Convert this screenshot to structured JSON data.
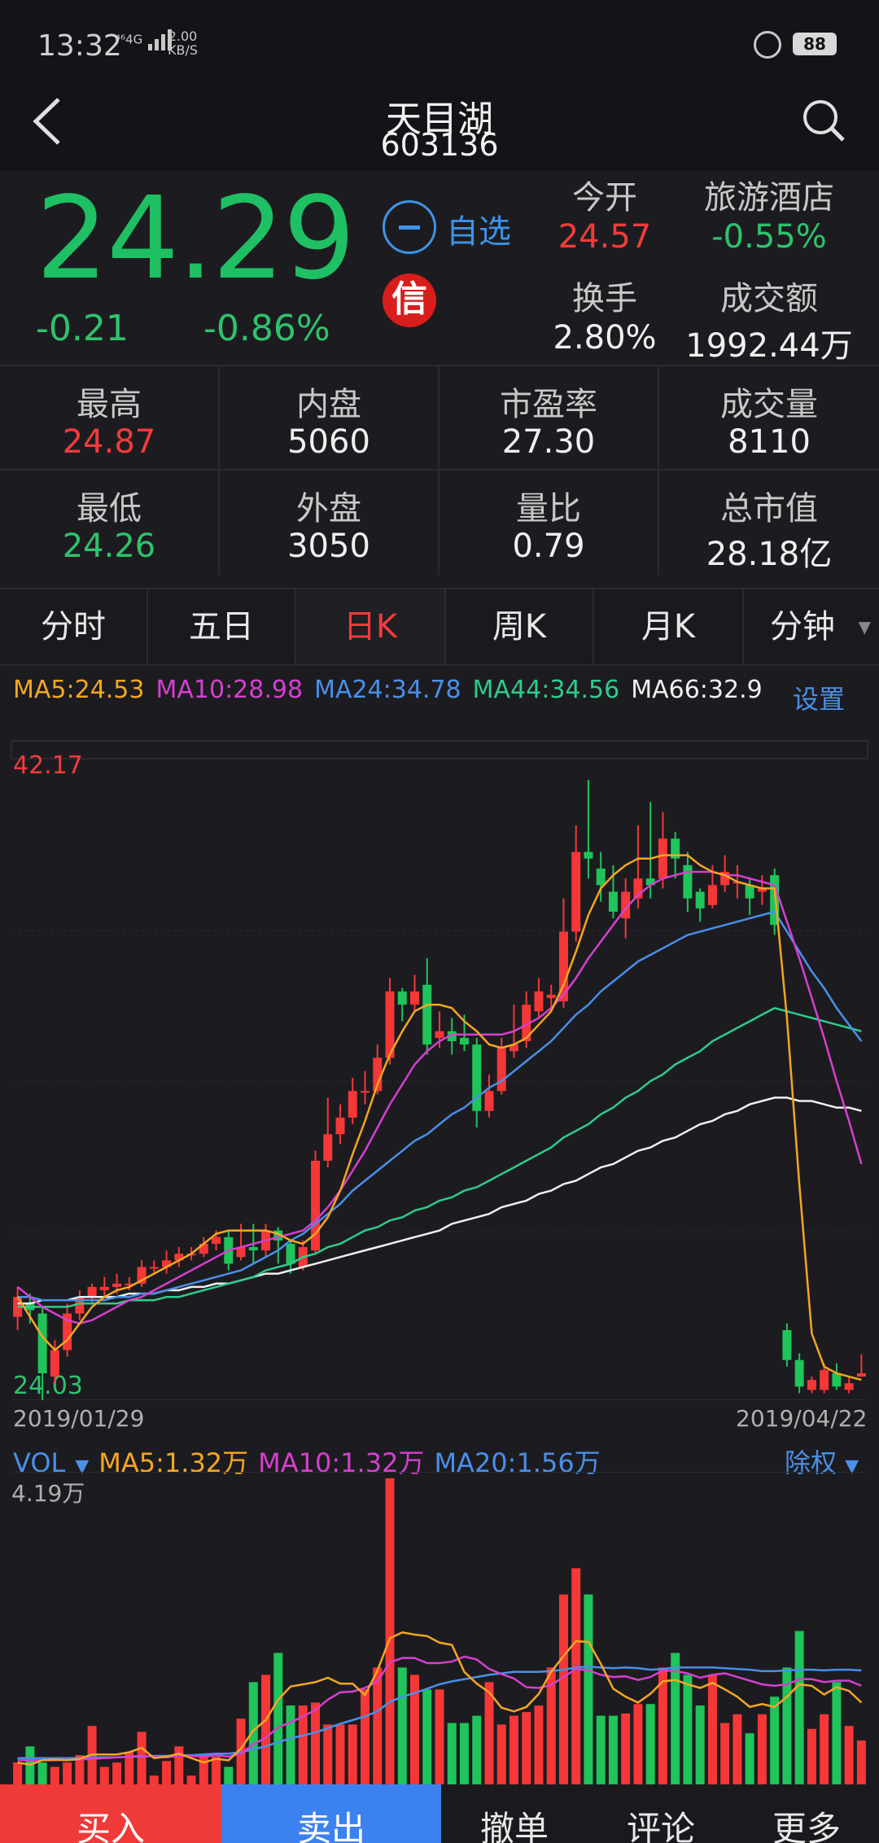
{
  "status": {
    "time": "13:32",
    "net": "⁴⁶4G",
    "speed_top": "2.00",
    "speed_bottom": "KB/S",
    "battery": "88"
  },
  "header": {
    "title": "天目湖",
    "code": "603136"
  },
  "quote": {
    "price": "24.29",
    "change": "-0.21",
    "change_pct": "-0.86%",
    "watch_label": "自选",
    "xin": "信",
    "open_label": "今开",
    "open_value": "24.57",
    "sector_label": "旅游酒店",
    "sector_value": "-0.55%",
    "turnover_label": "换手",
    "turnover_value": "2.80%",
    "amount_label": "成交额",
    "amount_value": "1992.44万"
  },
  "stats": [
    [
      {
        "label": "最高",
        "value": "24.87",
        "color": "#f23b3b"
      },
      {
        "label": "内盘",
        "value": "5060",
        "color": "#f0f0f0"
      },
      {
        "label": "市盈率",
        "value": "27.30",
        "color": "#f0f0f0"
      },
      {
        "label": "成交量",
        "value": "8110",
        "color": "#f0f0f0"
      }
    ],
    [
      {
        "label": "最低",
        "value": "24.26",
        "color": "#2ec36c"
      },
      {
        "label": "外盘",
        "value": "3050",
        "color": "#f0f0f0"
      },
      {
        "label": "量比",
        "value": "0.79",
        "color": "#f0f0f0"
      },
      {
        "label": "总市值",
        "value": "28.18亿",
        "color": "#f0f0f0"
      }
    ]
  ],
  "tabs": [
    "分时",
    "五日",
    "日K",
    "周K",
    "月K",
    "分钟"
  ],
  "tab_active": 2,
  "ma": [
    {
      "text": "MA5:24.53",
      "color": "#f5a623"
    },
    {
      "text": "MA10:28.98",
      "color": "#d63fd0"
    },
    {
      "text": "MA24:34.78",
      "color": "#4a8fe8"
    },
    {
      "text": "MA44:34.56",
      "color": "#2ecc8a"
    },
    {
      "text": "MA66:32.9",
      "color": "#f0f0f0"
    }
  ],
  "settings_label": "设置",
  "colors": {
    "up": "#f53737",
    "down": "#1fc45a"
  },
  "chart_data": {
    "type": "candlestick",
    "price_max_label": "42.17",
    "price_min_label": "24.03",
    "ylim": [
      24.03,
      42.17
    ],
    "date_start": "2019/01/29",
    "date_end": "2019/04/22",
    "candles": [
      [
        26.0,
        26.6,
        26.9,
        25.6
      ],
      [
        26.4,
        26.2,
        26.7,
        25.8
      ],
      [
        26.1,
        24.3,
        26.3,
        23.2
      ],
      [
        24.2,
        25.0,
        25.3,
        24.0
      ],
      [
        25.0,
        26.1,
        26.4,
        24.8
      ],
      [
        26.1,
        26.6,
        26.8,
        25.9
      ],
      [
        26.6,
        26.9,
        27.0,
        26.4
      ],
      [
        26.8,
        26.9,
        27.2,
        26.6
      ],
      [
        26.9,
        27.0,
        27.3,
        26.7
      ],
      [
        27.0,
        27.0,
        27.2,
        26.8
      ],
      [
        27.0,
        27.5,
        27.7,
        26.9
      ],
      [
        27.5,
        27.5,
        27.7,
        27.3
      ],
      [
        27.5,
        27.7,
        28.0,
        27.3
      ],
      [
        27.7,
        27.9,
        28.1,
        27.5
      ],
      [
        27.9,
        27.9,
        28.1,
        27.7
      ],
      [
        27.9,
        28.2,
        28.4,
        27.8
      ],
      [
        28.2,
        28.4,
        28.6,
        28.0
      ],
      [
        28.4,
        27.6,
        28.6,
        27.4
      ],
      [
        27.8,
        28.1,
        28.8,
        27.7
      ],
      [
        28.1,
        28.0,
        28.8,
        27.6
      ],
      [
        28.0,
        28.6,
        28.8,
        27.8
      ],
      [
        28.6,
        28.3,
        28.7,
        27.6
      ],
      [
        28.2,
        27.6,
        28.3,
        27.3
      ],
      [
        27.5,
        28.1,
        28.3,
        27.4
      ],
      [
        28.0,
        30.7,
        31.0,
        27.9
      ],
      [
        30.7,
        31.5,
        32.6,
        30.5
      ],
      [
        31.5,
        32.0,
        32.4,
        31.2
      ],
      [
        32.0,
        32.8,
        33.2,
        31.8
      ],
      [
        32.8,
        32.8,
        33.4,
        32.4
      ],
      [
        32.8,
        33.8,
        34.2,
        32.7
      ],
      [
        33.8,
        35.8,
        36.2,
        33.6
      ],
      [
        35.8,
        35.4,
        35.9,
        34.9
      ],
      [
        35.4,
        35.8,
        36.3,
        35.2
      ],
      [
        36.0,
        34.2,
        36.8,
        33.9
      ],
      [
        34.4,
        34.6,
        35.2,
        34.1
      ],
      [
        34.6,
        34.3,
        35.0,
        33.9
      ],
      [
        34.4,
        34.2,
        35.1,
        34.0
      ],
      [
        34.2,
        32.2,
        34.4,
        31.7
      ],
      [
        32.2,
        32.8,
        33.3,
        32.0
      ],
      [
        32.8,
        34.1,
        34.4,
        32.7
      ],
      [
        34.0,
        34.2,
        35.4,
        33.8
      ],
      [
        34.3,
        35.4,
        35.8,
        34.1
      ],
      [
        35.2,
        35.8,
        36.2,
        35.0
      ],
      [
        35.6,
        35.7,
        36.0,
        35.3
      ],
      [
        35.5,
        37.6,
        38.6,
        35.3
      ],
      [
        37.6,
        40.0,
        40.8,
        37.3
      ],
      [
        40.0,
        39.8,
        42.17,
        39.2
      ],
      [
        39.5,
        39.0,
        40.0,
        38.5
      ],
      [
        38.8,
        38.2,
        39.6,
        38.0
      ],
      [
        38.0,
        38.8,
        39.2,
        37.4
      ],
      [
        38.6,
        39.2,
        40.8,
        38.3
      ],
      [
        39.2,
        39.0,
        41.5,
        38.6
      ],
      [
        39.2,
        40.4,
        41.2,
        38.9
      ],
      [
        40.4,
        39.8,
        40.6,
        39.2
      ],
      [
        39.6,
        38.6,
        40.0,
        38.2
      ],
      [
        38.8,
        38.3,
        38.9,
        37.9
      ],
      [
        38.4,
        39.0,
        39.6,
        38.3
      ],
      [
        39.0,
        39.4,
        39.9,
        38.8
      ],
      [
        39.1,
        39.1,
        39.6,
        38.6
      ],
      [
        39.0,
        38.6,
        39.2,
        38.1
      ],
      [
        38.8,
        38.9,
        39.3,
        38.4
      ],
      [
        39.3,
        37.8,
        39.5,
        37.5
      ],
      [
        25.6,
        24.7,
        25.8,
        24.5
      ],
      [
        24.7,
        23.9,
        24.9,
        23.7
      ],
      [
        23.8,
        24.1,
        24.2,
        23.7
      ],
      [
        23.8,
        24.4,
        24.6,
        23.7
      ],
      [
        24.3,
        23.9,
        24.6,
        23.8
      ],
      [
        23.8,
        24.0,
        24.2,
        23.7
      ],
      [
        24.2,
        24.3,
        24.87,
        24.26
      ]
    ],
    "ma5": [
      26.6,
      26.0,
      25.4,
      25.0,
      25.3,
      25.8,
      26.3,
      26.6,
      26.8,
      26.9,
      27.1,
      27.3,
      27.5,
      27.7,
      27.9,
      28.2,
      28.5,
      28.6,
      28.6,
      28.6,
      28.6,
      28.5,
      28.3,
      28.2,
      28.5,
      29.0,
      29.8,
      30.9,
      31.9,
      33.0,
      33.9,
      34.6,
      35.2,
      35.4,
      35.4,
      35.3,
      34.9,
      34.6,
      34.2,
      34.1,
      34.2,
      34.4,
      34.8,
      35.2,
      36.0,
      37.0,
      38.1,
      38.9,
      39.3,
      39.6,
      39.8,
      39.8,
      39.9,
      39.9,
      39.9,
      39.6,
      39.4,
      39.3,
      39.1,
      39.0,
      38.9,
      38.9,
      35.0,
      30.0,
      25.5,
      24.5,
      24.3,
      24.2,
      24.1
    ],
    "ma10": [
      26.9,
      26.6,
      26.3,
      26.1,
      25.9,
      25.8,
      25.9,
      26.1,
      26.3,
      26.5,
      26.6,
      26.8,
      27.0,
      27.2,
      27.4,
      27.6,
      27.8,
      28.0,
      28.1,
      28.2,
      28.3,
      28.4,
      28.5,
      28.6,
      28.9,
      29.3,
      29.8,
      30.4,
      31.0,
      31.7,
      32.4,
      33.0,
      33.6,
      34.0,
      34.3,
      34.5,
      34.5,
      34.5,
      34.5,
      34.5,
      34.6,
      34.8,
      35.0,
      35.3,
      35.7,
      36.2,
      36.8,
      37.3,
      37.8,
      38.3,
      38.7,
      39.0,
      39.2,
      39.3,
      39.4,
      39.4,
      39.4,
      39.3,
      39.3,
      39.2,
      39.1,
      39.0,
      37.9,
      36.8,
      35.6,
      34.4,
      33.1,
      31.9,
      30.6
    ],
    "ma24": [
      26.6,
      26.6,
      26.5,
      26.5,
      26.5,
      26.5,
      26.5,
      26.5,
      26.6,
      26.6,
      26.7,
      26.7,
      26.8,
      26.9,
      27.0,
      27.1,
      27.2,
      27.3,
      27.4,
      27.6,
      27.8,
      28.0,
      28.3,
      28.5,
      28.8,
      29.1,
      29.4,
      29.8,
      30.1,
      30.4,
      30.7,
      31.0,
      31.3,
      31.5,
      31.8,
      32.1,
      32.3,
      32.6,
      32.9,
      33.1,
      33.4,
      33.7,
      34.0,
      34.3,
      34.7,
      35.1,
      35.4,
      35.8,
      36.1,
      36.4,
      36.7,
      36.9,
      37.1,
      37.3,
      37.5,
      37.6,
      37.7,
      37.8,
      37.9,
      38.0,
      38.1,
      38.2,
      37.6,
      37.0,
      36.4,
      35.9,
      35.3,
      34.8,
      34.3
    ],
    "ma44": [
      26.3,
      26.3,
      26.3,
      26.3,
      26.3,
      26.4,
      26.4,
      26.4,
      26.4,
      26.5,
      26.5,
      26.5,
      26.6,
      26.6,
      26.7,
      26.8,
      26.9,
      27.0,
      27.1,
      27.2,
      27.4,
      27.5,
      27.6,
      27.8,
      27.9,
      28.1,
      28.2,
      28.4,
      28.6,
      28.7,
      28.9,
      29.0,
      29.2,
      29.3,
      29.5,
      29.6,
      29.8,
      29.9,
      30.1,
      30.3,
      30.5,
      30.7,
      30.9,
      31.1,
      31.4,
      31.6,
      31.8,
      32.1,
      32.3,
      32.6,
      32.8,
      33.1,
      33.3,
      33.6,
      33.8,
      34.0,
      34.3,
      34.5,
      34.7,
      34.9,
      35.1,
      35.3,
      35.2,
      35.1,
      35.0,
      34.9,
      34.8,
      34.7,
      34.6
    ],
    "ma66": [
      26.4,
      26.4,
      26.5,
      26.5,
      26.5,
      26.6,
      26.6,
      26.6,
      26.6,
      26.7,
      26.7,
      26.7,
      26.8,
      26.8,
      26.9,
      26.9,
      27.0,
      27.0,
      27.1,
      27.2,
      27.3,
      27.3,
      27.4,
      27.5,
      27.6,
      27.7,
      27.8,
      27.9,
      28.0,
      28.1,
      28.2,
      28.3,
      28.4,
      28.5,
      28.6,
      28.8,
      28.9,
      29.0,
      29.1,
      29.3,
      29.4,
      29.5,
      29.7,
      29.8,
      30.0,
      30.1,
      30.3,
      30.5,
      30.6,
      30.8,
      31.0,
      31.1,
      31.3,
      31.4,
      31.6,
      31.8,
      31.9,
      32.1,
      32.2,
      32.4,
      32.5,
      32.6,
      32.6,
      32.5,
      32.5,
      32.4,
      32.3,
      32.3,
      32.2
    ]
  },
  "vol": {
    "label": "VOL",
    "items": [
      {
        "text": "MA5:1.32万",
        "color": "#f5a623"
      },
      {
        "text": "MA10:1.32万",
        "color": "#d63fd0"
      },
      {
        "text": "MA20:1.56万",
        "color": "#4a8fe8"
      }
    ],
    "fuquan": "除权",
    "max_label": "4.19万",
    "ylim": [
      0,
      4.19
    ],
    "volumes": [
      0.3,
      0.52,
      0.3,
      0.24,
      0.3,
      0.4,
      0.8,
      0.24,
      0.3,
      0.44,
      0.72,
      0.12,
      0.32,
      0.52,
      0.12,
      0.4,
      0.38,
      0.24,
      0.9,
      1.4,
      1.5,
      1.8,
      1.08,
      1.08,
      1.12,
      0.82,
      0.82,
      0.82,
      1.3,
      1.6,
      4.19,
      1.6,
      1.5,
      1.3,
      1.3,
      0.84,
      0.84,
      0.94,
      1.4,
      0.82,
      0.94,
      0.99,
      1.08,
      1.6,
      2.6,
      2.96,
      2.6,
      0.94,
      0.94,
      0.97,
      1.1,
      1.1,
      1.6,
      1.8,
      1.5,
      1.08,
      1.5,
      0.84,
      0.96,
      0.7,
      0.96,
      1.2,
      1.6,
      2.1,
      0.76,
      0.96,
      1.4,
      0.8,
      0.6
    ],
    "ma5": [
      0.3,
      0.27,
      0.33,
      0.34,
      0.33,
      0.35,
      0.41,
      0.41,
      0.41,
      0.44,
      0.5,
      0.36,
      0.38,
      0.42,
      0.36,
      0.3,
      0.35,
      0.33,
      0.49,
      0.74,
      0.88,
      1.16,
      1.34,
      1.37,
      1.4,
      1.46,
      1.38,
      1.38,
      1.22,
      1.56,
      2.0,
      2.08,
      2.05,
      2.03,
      1.94,
      1.91,
      1.54,
      1.38,
      1.26,
      1.05,
      1.0,
      1.06,
      1.24,
      1.54,
      1.76,
      1.96,
      1.95,
      1.65,
      1.31,
      1.2,
      1.12,
      1.24,
      1.41,
      1.43,
      1.37,
      1.32,
      1.39,
      1.3,
      1.2,
      1.06,
      1.1,
      1.06,
      1.2,
      1.37,
      1.35,
      1.23,
      1.33,
      1.28,
      1.12
    ],
    "ma10": [
      0.33,
      0.33,
      0.33,
      0.33,
      0.34,
      0.34,
      0.35,
      0.36,
      0.37,
      0.38,
      0.39,
      0.38,
      0.37,
      0.39,
      0.39,
      0.38,
      0.4,
      0.38,
      0.42,
      0.55,
      0.64,
      0.78,
      0.85,
      0.93,
      1.02,
      1.16,
      1.26,
      1.27,
      1.32,
      1.41,
      1.67,
      1.73,
      1.73,
      1.66,
      1.66,
      1.68,
      1.75,
      1.71,
      1.58,
      1.51,
      1.45,
      1.33,
      1.32,
      1.36,
      1.47,
      1.58,
      1.56,
      1.5,
      1.47,
      1.48,
      1.43,
      1.47,
      1.56,
      1.55,
      1.52,
      1.46,
      1.5,
      1.52,
      1.47,
      1.42,
      1.37,
      1.35,
      1.37,
      1.44,
      1.44,
      1.4,
      1.42,
      1.42,
      1.35
    ],
    "ma20": [
      0.36,
      0.36,
      0.36,
      0.36,
      0.36,
      0.36,
      0.37,
      0.37,
      0.37,
      0.38,
      0.38,
      0.39,
      0.39,
      0.4,
      0.4,
      0.41,
      0.42,
      0.42,
      0.44,
      0.48,
      0.52,
      0.58,
      0.63,
      0.67,
      0.71,
      0.77,
      0.83,
      0.88,
      0.93,
      1.0,
      1.13,
      1.2,
      1.25,
      1.31,
      1.37,
      1.41,
      1.44,
      1.47,
      1.5,
      1.52,
      1.54,
      1.54,
      1.54,
      1.55,
      1.57,
      1.6,
      1.61,
      1.6,
      1.59,
      1.6,
      1.59,
      1.57,
      1.58,
      1.6,
      1.6,
      1.6,
      1.6,
      1.59,
      1.58,
      1.57,
      1.55,
      1.55,
      1.56,
      1.57,
      1.57,
      1.56,
      1.57,
      1.57,
      1.56
    ]
  },
  "bottom": [
    {
      "label": "买入",
      "bg": "#f03a3a",
      "color": "#ffffff"
    },
    {
      "label": "卖出",
      "bg": "#3b82f0",
      "color": "#ffffff"
    },
    {
      "label": "撤单",
      "bg": "#1a1a1e",
      "color": "#e8e8e8"
    },
    {
      "label": "评论",
      "bg": "#1a1a1e",
      "color": "#e8e8e8"
    },
    {
      "label": "更多",
      "bg": "#1a1a1e",
      "color": "#e8e8e8"
    }
  ]
}
